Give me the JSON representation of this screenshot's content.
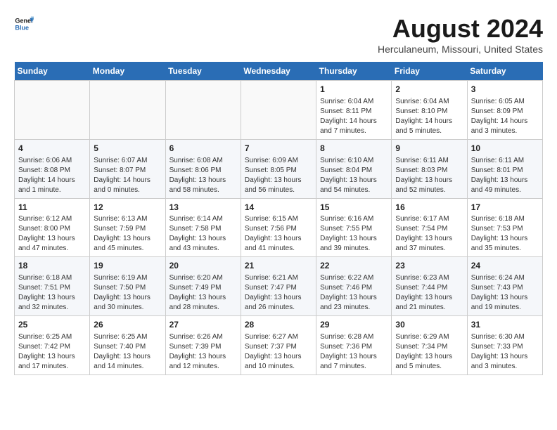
{
  "logo": {
    "text_general": "General",
    "text_blue": "Blue"
  },
  "header": {
    "title": "August 2024",
    "subtitle": "Herculaneum, Missouri, United States"
  },
  "weekdays": [
    "Sunday",
    "Monday",
    "Tuesday",
    "Wednesday",
    "Thursday",
    "Friday",
    "Saturday"
  ],
  "weeks": [
    [
      {
        "day": "",
        "info": ""
      },
      {
        "day": "",
        "info": ""
      },
      {
        "day": "",
        "info": ""
      },
      {
        "day": "",
        "info": ""
      },
      {
        "day": "1",
        "info": "Sunrise: 6:04 AM\nSunset: 8:11 PM\nDaylight: 14 hours\nand 7 minutes."
      },
      {
        "day": "2",
        "info": "Sunrise: 6:04 AM\nSunset: 8:10 PM\nDaylight: 14 hours\nand 5 minutes."
      },
      {
        "day": "3",
        "info": "Sunrise: 6:05 AM\nSunset: 8:09 PM\nDaylight: 14 hours\nand 3 minutes."
      }
    ],
    [
      {
        "day": "4",
        "info": "Sunrise: 6:06 AM\nSunset: 8:08 PM\nDaylight: 14 hours\nand 1 minute."
      },
      {
        "day": "5",
        "info": "Sunrise: 6:07 AM\nSunset: 8:07 PM\nDaylight: 14 hours\nand 0 minutes."
      },
      {
        "day": "6",
        "info": "Sunrise: 6:08 AM\nSunset: 8:06 PM\nDaylight: 13 hours\nand 58 minutes."
      },
      {
        "day": "7",
        "info": "Sunrise: 6:09 AM\nSunset: 8:05 PM\nDaylight: 13 hours\nand 56 minutes."
      },
      {
        "day": "8",
        "info": "Sunrise: 6:10 AM\nSunset: 8:04 PM\nDaylight: 13 hours\nand 54 minutes."
      },
      {
        "day": "9",
        "info": "Sunrise: 6:11 AM\nSunset: 8:03 PM\nDaylight: 13 hours\nand 52 minutes."
      },
      {
        "day": "10",
        "info": "Sunrise: 6:11 AM\nSunset: 8:01 PM\nDaylight: 13 hours\nand 49 minutes."
      }
    ],
    [
      {
        "day": "11",
        "info": "Sunrise: 6:12 AM\nSunset: 8:00 PM\nDaylight: 13 hours\nand 47 minutes."
      },
      {
        "day": "12",
        "info": "Sunrise: 6:13 AM\nSunset: 7:59 PM\nDaylight: 13 hours\nand 45 minutes."
      },
      {
        "day": "13",
        "info": "Sunrise: 6:14 AM\nSunset: 7:58 PM\nDaylight: 13 hours\nand 43 minutes."
      },
      {
        "day": "14",
        "info": "Sunrise: 6:15 AM\nSunset: 7:56 PM\nDaylight: 13 hours\nand 41 minutes."
      },
      {
        "day": "15",
        "info": "Sunrise: 6:16 AM\nSunset: 7:55 PM\nDaylight: 13 hours\nand 39 minutes."
      },
      {
        "day": "16",
        "info": "Sunrise: 6:17 AM\nSunset: 7:54 PM\nDaylight: 13 hours\nand 37 minutes."
      },
      {
        "day": "17",
        "info": "Sunrise: 6:18 AM\nSunset: 7:53 PM\nDaylight: 13 hours\nand 35 minutes."
      }
    ],
    [
      {
        "day": "18",
        "info": "Sunrise: 6:18 AM\nSunset: 7:51 PM\nDaylight: 13 hours\nand 32 minutes."
      },
      {
        "day": "19",
        "info": "Sunrise: 6:19 AM\nSunset: 7:50 PM\nDaylight: 13 hours\nand 30 minutes."
      },
      {
        "day": "20",
        "info": "Sunrise: 6:20 AM\nSunset: 7:49 PM\nDaylight: 13 hours\nand 28 minutes."
      },
      {
        "day": "21",
        "info": "Sunrise: 6:21 AM\nSunset: 7:47 PM\nDaylight: 13 hours\nand 26 minutes."
      },
      {
        "day": "22",
        "info": "Sunrise: 6:22 AM\nSunset: 7:46 PM\nDaylight: 13 hours\nand 23 minutes."
      },
      {
        "day": "23",
        "info": "Sunrise: 6:23 AM\nSunset: 7:44 PM\nDaylight: 13 hours\nand 21 minutes."
      },
      {
        "day": "24",
        "info": "Sunrise: 6:24 AM\nSunset: 7:43 PM\nDaylight: 13 hours\nand 19 minutes."
      }
    ],
    [
      {
        "day": "25",
        "info": "Sunrise: 6:25 AM\nSunset: 7:42 PM\nDaylight: 13 hours\nand 17 minutes."
      },
      {
        "day": "26",
        "info": "Sunrise: 6:25 AM\nSunset: 7:40 PM\nDaylight: 13 hours\nand 14 minutes."
      },
      {
        "day": "27",
        "info": "Sunrise: 6:26 AM\nSunset: 7:39 PM\nDaylight: 13 hours\nand 12 minutes."
      },
      {
        "day": "28",
        "info": "Sunrise: 6:27 AM\nSunset: 7:37 PM\nDaylight: 13 hours\nand 10 minutes."
      },
      {
        "day": "29",
        "info": "Sunrise: 6:28 AM\nSunset: 7:36 PM\nDaylight: 13 hours\nand 7 minutes."
      },
      {
        "day": "30",
        "info": "Sunrise: 6:29 AM\nSunset: 7:34 PM\nDaylight: 13 hours\nand 5 minutes."
      },
      {
        "day": "31",
        "info": "Sunrise: 6:30 AM\nSunset: 7:33 PM\nDaylight: 13 hours\nand 3 minutes."
      }
    ]
  ]
}
